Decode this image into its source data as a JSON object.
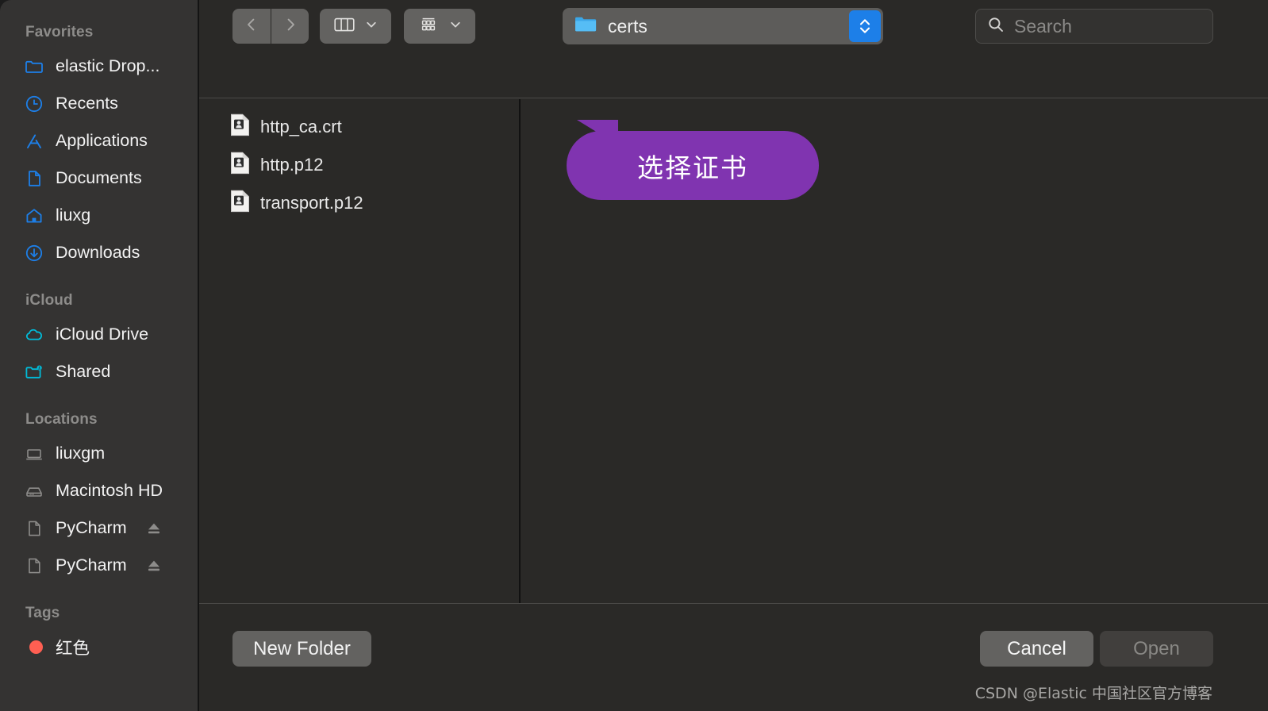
{
  "window": {
    "title": "Open file dialog",
    "watermark": "CSDN @Elastic 中国社区官方博客"
  },
  "colors": {
    "sidebar_bg": "#343332",
    "main_bg": "#2a2927",
    "accent_blue": "#1d7fe8",
    "favorites_icon": "#1d7fe8",
    "icloud_icon": "#00bcd9",
    "locations_icon": "#8d8c8a",
    "callout_purple": "#8034b0",
    "tag_red": "#ff5f52"
  },
  "sidebar": {
    "sections": [
      {
        "title": "Favorites",
        "items": [
          {
            "label": "elastic Drop...",
            "icon": "folder-icon"
          },
          {
            "label": "Recents",
            "icon": "clock-icon"
          },
          {
            "label": "Applications",
            "icon": "applications-icon"
          },
          {
            "label": "Documents",
            "icon": "document-icon"
          },
          {
            "label": "liuxg",
            "icon": "home-icon"
          },
          {
            "label": "Downloads",
            "icon": "download-icon"
          }
        ]
      },
      {
        "title": "iCloud",
        "items": [
          {
            "label": "iCloud Drive",
            "icon": "cloud-icon"
          },
          {
            "label": "Shared",
            "icon": "shared-folder-icon"
          }
        ]
      },
      {
        "title": "Locations",
        "items": [
          {
            "label": "liuxgm",
            "icon": "laptop-icon"
          },
          {
            "label": "Macintosh HD",
            "icon": "harddisk-icon"
          },
          {
            "label": "PyCharm",
            "icon": "disk-image-icon",
            "eject": true
          },
          {
            "label": "PyCharm",
            "icon": "disk-image-icon",
            "eject": true
          }
        ]
      },
      {
        "title": "Tags",
        "items": [
          {
            "label": "红色",
            "icon": "red-tag-dot"
          }
        ]
      }
    ]
  },
  "toolbar": {
    "back_icon": "chevron-left-icon",
    "forward_icon": "chevron-right-icon",
    "view_column_icon": "column-view-icon",
    "view_group_icon": "group-by-icon",
    "dropdown_icon": "chevron-down-icon",
    "path": {
      "label": "certs",
      "icon": "blue-folder-icon",
      "stepper_icon": "stepper-up-down-icon"
    },
    "search": {
      "placeholder": "Search",
      "value": "",
      "icon": "search-icon"
    }
  },
  "files": [
    {
      "name": "http_ca.crt",
      "icon": "certificate-file-icon"
    },
    {
      "name": "http.p12",
      "icon": "certificate-file-icon"
    },
    {
      "name": "transport.p12",
      "icon": "certificate-file-icon"
    }
  ],
  "callout": {
    "text": "选择证书"
  },
  "footer": {
    "new_folder_label": "New Folder",
    "cancel_label": "Cancel",
    "open_label": "Open",
    "open_disabled": true
  }
}
